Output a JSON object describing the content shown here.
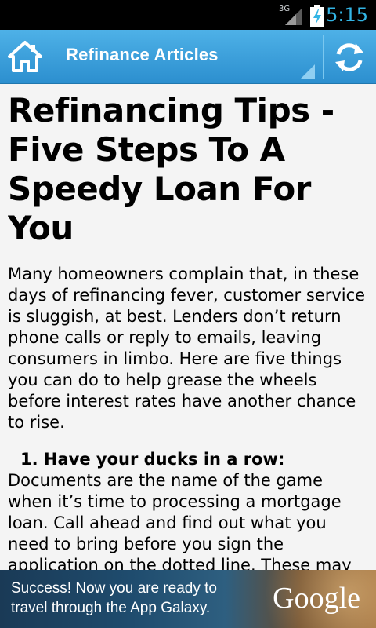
{
  "status_bar": {
    "network": "3G",
    "time": "5:15"
  },
  "action_bar": {
    "title": "Refinance Articles"
  },
  "article": {
    "title": "Refinancing Tips - Five Steps To A Speedy Loan For You",
    "intro": "Many homeowners complain that, in these days of refinancing fever, customer service is sluggish, at best. Lenders don’t return phone calls or reply to emails, leaving consumers in limbo. Here are five things you can do to help grease the wheels before interest rates have another chance to rise.",
    "step1_heading": "1. Have your ducks in a row:",
    "step1_text": "Documents are the name of the game when it’s time to processing a mortgage loan. Call ahead and find out what you need to bring before you sign the application on the dotted line. These may include tax returns, legal papers, or your spouse (to sign paperwork). If you have"
  },
  "ad": {
    "text": "Success! Now you are ready to travel through the App Galaxy.",
    "brand": "Google"
  },
  "colors": {
    "accent": "#33b5e5",
    "action_bar": "#3aa0dc"
  }
}
